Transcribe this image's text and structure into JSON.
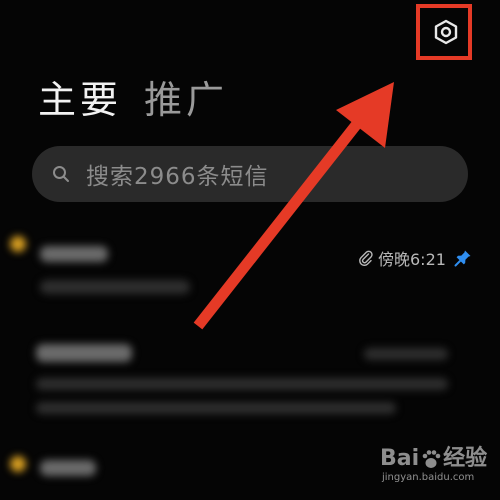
{
  "header": {
    "settings_icon": "hexagon-settings-icon",
    "highlight_color": "#e53a26"
  },
  "tabs": [
    {
      "label": "主要",
      "active": true
    },
    {
      "label": "推广",
      "active": false
    }
  ],
  "search": {
    "placeholder": "搜索2966条短信",
    "icon": "search-icon"
  },
  "message_list": {
    "first_item": {
      "time": "傍晚6:21",
      "attachment_icon": "paperclip-icon",
      "pinned_icon": "pin-icon",
      "pin_color": "#2f8ef0"
    }
  },
  "annotation": {
    "arrow_color": "#e53a26"
  },
  "watermark": {
    "brand": "Bai",
    "brand_suffix": "经验",
    "url": "jingyan.baidu.com"
  }
}
